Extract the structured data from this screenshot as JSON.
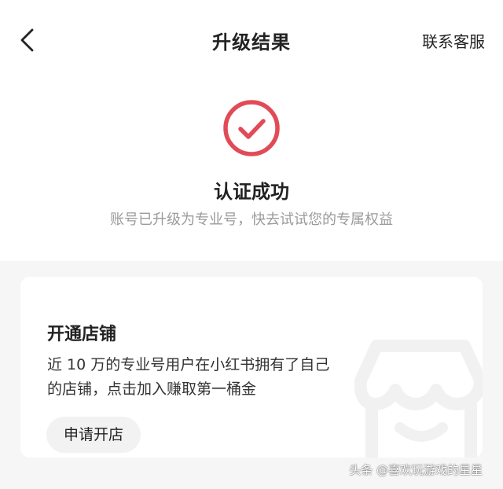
{
  "nav": {
    "title": "升级结果",
    "contact_label": "联系客服",
    "back_icon": "chevron-left-icon"
  },
  "result": {
    "icon": "check-circle-icon",
    "icon_color": "#e14b57",
    "title": "认证成功",
    "description": "账号已升级为专业号，快去试试您的专属权益"
  },
  "shop_card": {
    "title": "开通店铺",
    "description": "近 10 万的专业号用户在小红书拥有了自己的店铺，点击加入赚取第一桶金",
    "button_label": "申请开店",
    "decor_icon": "shop-icon"
  },
  "watermark": "头条 @喜欢玩游戏的星星",
  "colors": {
    "background_top": "#ffffff",
    "background_bottom": "#f6f6f6",
    "card": "#ffffff",
    "button": "#f2f2f2",
    "muted_text": "#9b9b9b",
    "accent": "#e14b57"
  }
}
